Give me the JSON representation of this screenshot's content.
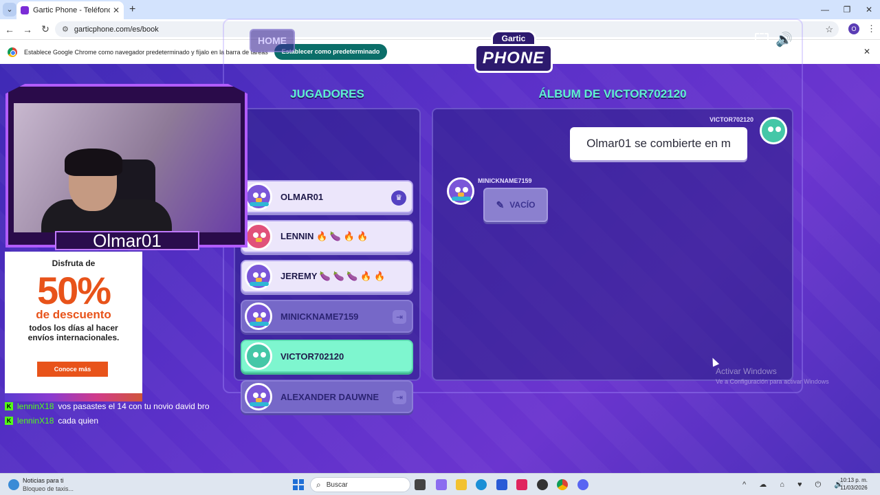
{
  "browser": {
    "tab_title": "Gartic Phone - Teléfono Descor",
    "url": "garticphone.com/es/book",
    "profile_initial": "O",
    "infobar_text": "Establece Google Chrome como navegador predeterminado y fíjalo en la barra de tareas",
    "infobar_button": "Establecer como predeterminado"
  },
  "game": {
    "home_label": "HOME",
    "logo_top": "Gartic",
    "logo_bottom": "PHONE",
    "players_heading": "JUGADORES",
    "album_heading": "ÁLBUM DE VICTOR702120",
    "players": [
      {
        "name": "OLMAR01",
        "status": "host"
      },
      {
        "name": "LENNIN 🔥 🍆 🔥 🔥",
        "status": "active"
      },
      {
        "name": "JEREMY 🍆 🍆 🍆 🔥 🔥",
        "status": "active"
      },
      {
        "name": "MINICKNAME7159",
        "status": "left"
      },
      {
        "name": "VICTOR702120",
        "status": "current"
      },
      {
        "name": "ALEXANDER DAUWNE",
        "status": "left"
      }
    ],
    "album": {
      "first_author": "VICTOR702120",
      "first_text": "Olmar01 se combierte en m",
      "second_author": "MINICKNAME7159",
      "second_text": "VACÍO"
    }
  },
  "overlay": {
    "streamer_name": "Olmar01",
    "ad": {
      "line1": "Disfruta de",
      "line2": "50%",
      "line3": "de descuento",
      "line4": "todos los días al hacer envíos internacionales.",
      "button": "Conoce más"
    },
    "chat": [
      {
        "user": "lenninX18",
        "message": "vos pasastes el 14 con tu novio david bro"
      },
      {
        "user": "lenninX18",
        "message": "cada quien"
      }
    ]
  },
  "windows": {
    "activate_title": "Activar Windows",
    "activate_sub": "Ve a Configuración para activar Windows",
    "news_title": "Noticias para ti",
    "news_sub": "Bloqueo de taxis...",
    "search_placeholder": "Buscar",
    "time": "10:13 p. m.",
    "date": "11/03/2026"
  },
  "colors": {
    "accent_teal": "#5ff0d0",
    "current_player": "#7ef6cf",
    "brand_purple": "#5a30c8"
  }
}
